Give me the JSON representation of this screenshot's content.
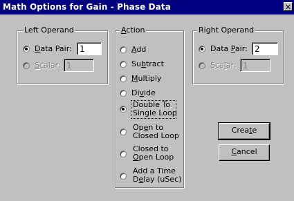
{
  "window": {
    "title": "Math Options for Gain - Phase Data",
    "close_glyph": "✕"
  },
  "left_operand": {
    "label": "Left Operand",
    "data_pair": {
      "label": "Data Pair:",
      "mnemonic": "D",
      "value": "1",
      "selected": true
    },
    "scalar": {
      "label": "Scalar:",
      "mnemonic": "S",
      "value": "1",
      "enabled": false
    }
  },
  "action": {
    "label": "Action",
    "selected": "Double To Single Loop",
    "options": [
      {
        "text": "Add",
        "mnemonic": "A"
      },
      {
        "text": "Subtract",
        "mnemonic": "b"
      },
      {
        "text": "Multiply",
        "mnemonic": "M"
      },
      {
        "text": "Divide",
        "mnemonic": "v"
      },
      {
        "line1": "Double To",
        "line2": "Single Loop"
      },
      {
        "line1": "Open to",
        "line2": "Closed Loop",
        "mnemonic": "e"
      },
      {
        "line1": "Closed to",
        "line2": "Open Loop",
        "mnemonic": "O"
      },
      {
        "line1": "Add a Time",
        "line2": "Delay (uSec)",
        "mnemonic": "e"
      }
    ]
  },
  "right_operand": {
    "label": "Right Operand",
    "data_pair": {
      "label": "Data Pair:",
      "mnemonic": "P",
      "value": "2",
      "selected": true
    },
    "scalar": {
      "label": "Scalar:",
      "mnemonic": "l",
      "value": "1",
      "enabled": false
    }
  },
  "buttons": {
    "create": {
      "label": "Create",
      "mnemonic": "t"
    },
    "cancel": {
      "label": "Cancel",
      "mnemonic": "C"
    }
  }
}
